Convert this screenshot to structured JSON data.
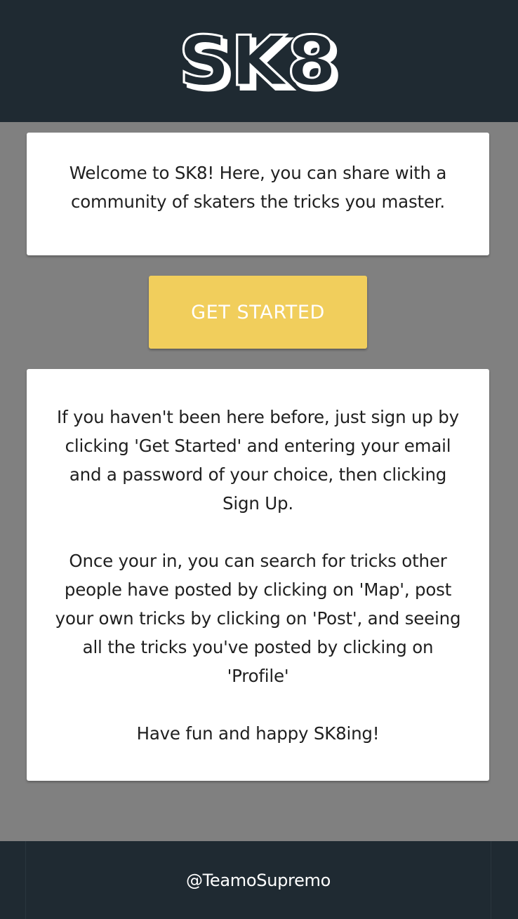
{
  "header": {
    "logo_text": "SK8"
  },
  "welcome": {
    "text": "Welcome to SK8! Here, you can share with a community of skaters the tricks you master."
  },
  "cta": {
    "label": "GET STARTED"
  },
  "info": {
    "paragraphs": [
      "If you haven't been here before, just sign up by clicking 'Get Started' and entering your email and a password of your choice, then clicking Sign Up.",
      "Once your in, you can search for tricks other people have posted by clicking on 'Map', post your own tricks by clicking on 'Post', and seeing all the tricks you've posted by clicking on 'Profile'",
      "Have fun and happy SK8ing!"
    ]
  },
  "footer": {
    "handle": "@TeamoSupremo"
  },
  "colors": {
    "header_bg": "#1f2a32",
    "page_bg": "#808080",
    "card_bg": "#ffffff",
    "accent": "#f1ce5c",
    "text": "#1f1f1f"
  }
}
